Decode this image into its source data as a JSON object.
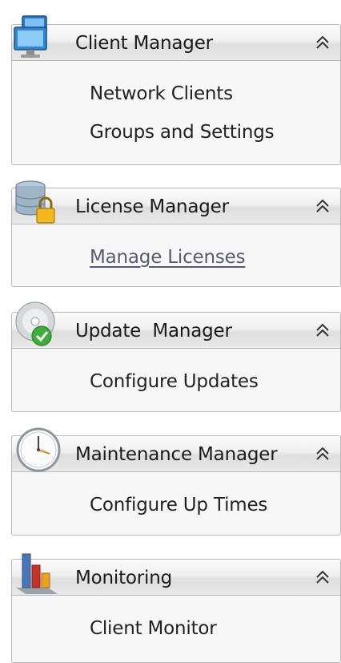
{
  "groups": [
    {
      "title": "Client Manager",
      "icon": "monitor-network-icon",
      "collapse_icon": "double-chevron-up-icon",
      "items": [
        {
          "label": "Network Clients",
          "underlined": false
        },
        {
          "label": "Groups and Settings",
          "underlined": false
        }
      ]
    },
    {
      "title": "License Manager",
      "icon": "database-lock-icon",
      "collapse_icon": "double-chevron-up-icon",
      "items": [
        {
          "label": "Manage Licenses",
          "underlined": true
        }
      ]
    },
    {
      "title": "Update  Manager",
      "icon": "disc-check-icon",
      "collapse_icon": "double-chevron-up-icon",
      "items": [
        {
          "label": "Configure Updates",
          "underlined": false
        }
      ]
    },
    {
      "title": "Maintenance Manager",
      "icon": "clock-icon",
      "collapse_icon": "double-chevron-up-icon",
      "items": [
        {
          "label": "Configure Up Times",
          "underlined": false
        }
      ]
    },
    {
      "title": "Monitoring",
      "icon": "bar-chart-icon",
      "collapse_icon": "double-chevron-up-icon",
      "items": [
        {
          "label": "Client Monitor",
          "underlined": false
        }
      ]
    }
  ],
  "colors": {
    "header_gradient_top": "#fbfbfb",
    "header_gradient_bottom": "#dedede",
    "border": "#b9b9b9",
    "body_background": "#f7f7f7",
    "text": "#222222",
    "link_hover": "#5a5a6e"
  }
}
